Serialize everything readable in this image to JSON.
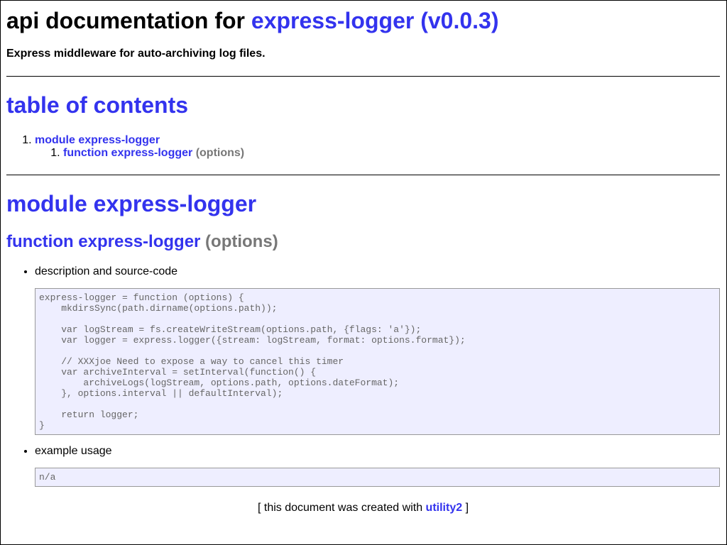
{
  "header": {
    "title_prefix": "api documentation for",
    "title_link": "express-logger (v0.0.3)",
    "subtitle": "Express middleware for auto-archiving log files."
  },
  "toc": {
    "heading": "table of contents",
    "items": [
      {
        "label": "module express-logger",
        "children": [
          {
            "label": "function express-logger",
            "params": "(options)"
          }
        ]
      }
    ]
  },
  "module": {
    "heading": "module express-logger",
    "function": {
      "name": "function express-logger",
      "params": "(options)",
      "sections": [
        {
          "label": "description and source-code",
          "code": "express-logger = function (options) {\n    mkdirsSync(path.dirname(options.path));\n\n    var logStream = fs.createWriteStream(options.path, {flags: 'a'});\n    var logger = express.logger({stream: logStream, format: options.format});\n\n    // XXXjoe Need to expose a way to cancel this timer\n    var archiveInterval = setInterval(function() {\n        archiveLogs(logStream, options.path, options.dateFormat);\n    }, options.interval || defaultInterval);\n\n    return logger;\n}"
        },
        {
          "label": "example usage",
          "code": "n/a"
        }
      ]
    }
  },
  "footer": {
    "open": "[ this document was created with",
    "link": "utility2",
    "close": "]"
  }
}
